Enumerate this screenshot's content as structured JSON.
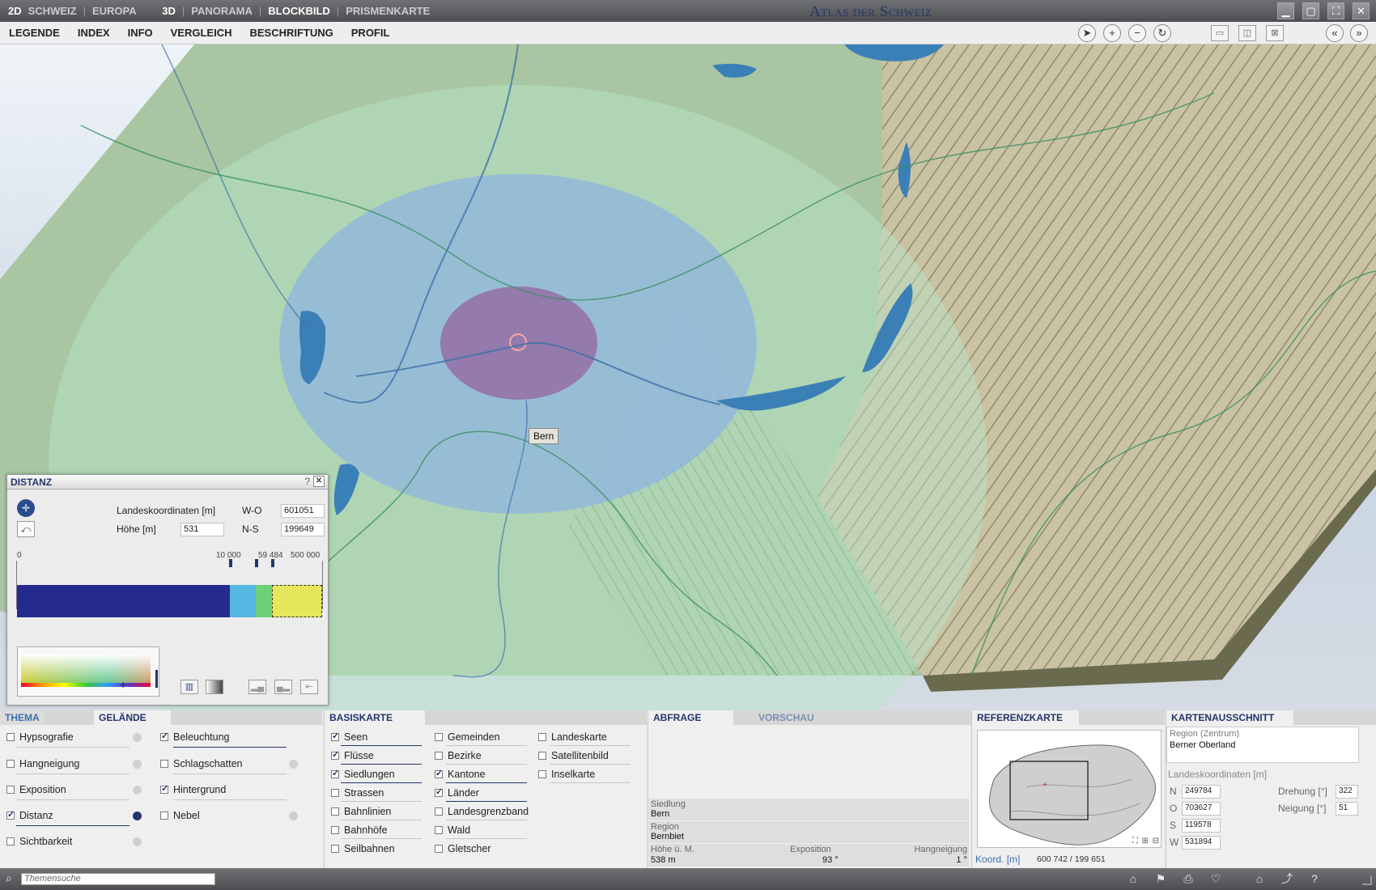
{
  "topbar": {
    "nav": [
      "2D",
      "SCHWEIZ",
      "EUROPA",
      "3D",
      "PANORAMA",
      "BLOCKBILD",
      "PRISMENKARTE"
    ],
    "active": "BLOCKBILD",
    "title": "Atlas der Schweiz"
  },
  "menu": [
    "LEGENDE",
    "INDEX",
    "INFO",
    "VERGLEICH",
    "BESCHRIFTUNG",
    "PROFIL"
  ],
  "map": {
    "label": "Bern"
  },
  "distanz": {
    "title": "DISTANZ",
    "help": "?",
    "coords_label": "Landeskoordinaten [m]",
    "wo_label": "W-O",
    "wo_value": "601051",
    "height_label": "Höhe [m]",
    "height_value": "531",
    "ns_label": "N-S",
    "ns_value": "199649",
    "scale": [
      "0",
      "10 000",
      "59 484",
      "500 000"
    ]
  },
  "thema": {
    "tab_thema": "THEMA",
    "tab_gelaende": "GELÄNDE",
    "col1": [
      {
        "label": "Hypsografie",
        "on": false
      },
      {
        "label": "Hangneigung",
        "on": false
      },
      {
        "label": "Exposition",
        "on": false
      },
      {
        "label": "Distanz",
        "on": true
      },
      {
        "label": "Sichtbarkeit",
        "on": false
      }
    ],
    "col2": [
      {
        "label": "Beleuchtung",
        "on": true
      },
      {
        "label": "Schlagschatten",
        "on": false
      },
      {
        "label": "Hintergrund",
        "on": true
      },
      {
        "label": "Nebel",
        "on": false
      }
    ]
  },
  "basiskarte": {
    "title": "BASISKARTE",
    "col1": [
      {
        "label": "Seen",
        "on": true
      },
      {
        "label": "Flüsse",
        "on": true
      },
      {
        "label": "Siedlungen",
        "on": true
      },
      {
        "label": "Strassen",
        "on": false
      },
      {
        "label": "Bahnlinien",
        "on": false
      },
      {
        "label": "Bahnhöfe",
        "on": false
      },
      {
        "label": "Seilbahnen",
        "on": false
      }
    ],
    "col2": [
      {
        "label": "Gemeinden",
        "on": false
      },
      {
        "label": "Bezirke",
        "on": false
      },
      {
        "label": "Kantone",
        "on": true
      },
      {
        "label": "Länder",
        "on": true
      },
      {
        "label": "Landesgrenzband",
        "on": false
      },
      {
        "label": "Wald",
        "on": false
      },
      {
        "label": "Gletscher",
        "on": false
      }
    ],
    "col3": [
      {
        "label": "Landeskarte",
        "on": false
      },
      {
        "label": "Satellitenbild",
        "on": false
      },
      {
        "label": "Inselkarte",
        "on": false
      }
    ]
  },
  "abfrage": {
    "tab1": "ABFRAGE",
    "tab2": "VORSCHAU",
    "siedlung_label": "Siedlung",
    "siedlung_value": "Bern",
    "region_label": "Region",
    "region_value": "Bernbiet",
    "hoehe_label": "Höhe ü. M.",
    "hoehe_value": "538 m",
    "exposition_label": "Exposition",
    "exposition_value": "93 °",
    "hangneigung_label": "Hangneigung",
    "hangneigung_value": "1 °"
  },
  "referenzkarte": {
    "title": "REFERENZKARTE",
    "koord_label": "Koord. [m]",
    "koord_value": "600 742 / 199 651"
  },
  "kartenausschnitt": {
    "title": "KARTENAUSSCHNITT",
    "region_label": "Region (Zentrum)",
    "region_value": "Berner Oberland",
    "coords_label": "Landeskoordinaten [m]",
    "n_label": "N",
    "n_value": "249784",
    "o_label": "O",
    "o_value": "703627",
    "s_label": "S",
    "s_value": "119578",
    "w_label": "W",
    "w_value": "531894",
    "drehung_label": "Drehung [°]",
    "drehung_value": "322",
    "neigung_label": "Neigung [°]",
    "neigung_value": "51"
  },
  "status": {
    "search_placeholder": "Themensuche"
  }
}
